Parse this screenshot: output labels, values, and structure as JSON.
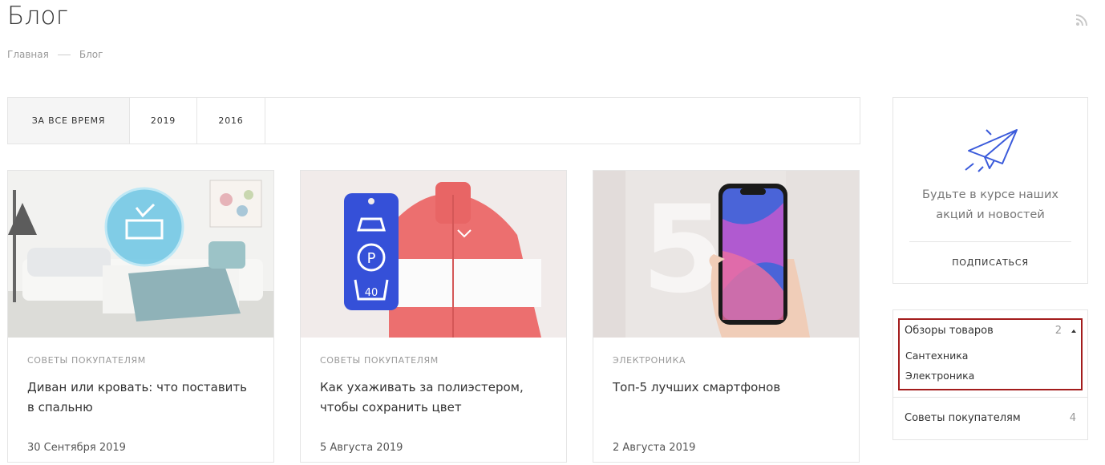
{
  "page": {
    "title": "Блог"
  },
  "breadcrumb": {
    "home": "Главная",
    "current": "Блог"
  },
  "tabs": [
    {
      "label": "ЗА ВСЕ ВРЕМЯ",
      "active": true
    },
    {
      "label": "2019",
      "active": false
    },
    {
      "label": "2016",
      "active": false
    }
  ],
  "posts": [
    {
      "category": "СОВЕТЫ ПОКУПАТЕЛЯМ",
      "title": "Диван или кровать: что поставить в спальню",
      "date": "30 Сентября 2019",
      "image": "sofa-bed-photo"
    },
    {
      "category": "СОВЕТЫ ПОКУПАТЕЛЯМ",
      "title": "Как ухаживать за полиэстером, чтобы сохранить цвет",
      "date": "5 Августа 2019",
      "image": "jacket-care-label-photo",
      "label_number": "40"
    },
    {
      "category": "ЭЛЕКТРОНИКА",
      "title": "Топ-5 лучших смартфонов",
      "date": "2 Августа 2019",
      "image": "smartphone-hand-photo",
      "big_digit": "5"
    }
  ],
  "subscribe": {
    "text": "Будьте в курсе наших акций и новостей",
    "link": "ПОДПИСАТЬСЯ"
  },
  "categories": {
    "open": {
      "label": "Обзоры товаров",
      "count": "2",
      "children": [
        "Сантехника",
        "Электроника"
      ]
    },
    "other": {
      "label": "Советы покупателям",
      "count": "4"
    }
  },
  "colors": {
    "accent": "#3b5bdb",
    "highlight_border": "#a31c1c",
    "border": "#e5e5e5"
  }
}
